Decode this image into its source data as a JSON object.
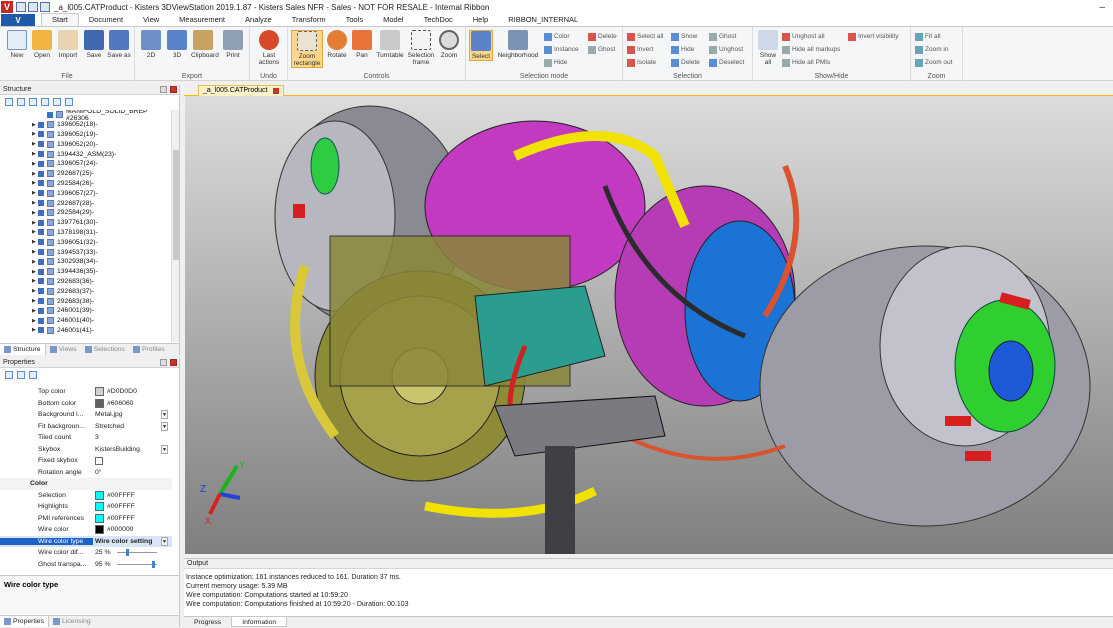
{
  "window": {
    "title": "_a_l005.CATProduct - Kisters 3DViewStation 2019.1.87 - Kisters Sales NFR - Sales - NOT FOR RESALE - Internal Ribbon",
    "logo": "V",
    "minimize_glyph": "–"
  },
  "menu": {
    "app_button": "V",
    "tabs": [
      "Start",
      "Document",
      "View",
      "Measurement",
      "Analyze",
      "Transform",
      "Tools",
      "Model",
      "TechDoc",
      "Help",
      "RIBBON_INTERNAL"
    ],
    "active_tab": "Start"
  },
  "ribbon": {
    "file": {
      "label": "File",
      "buttons": [
        "New",
        "Open",
        "Import",
        "Save",
        "Save as"
      ]
    },
    "export": {
      "label": "Export",
      "buttons": [
        "2D",
        "3D",
        "Clipboard",
        "Print"
      ]
    },
    "undo": {
      "label": "Undo",
      "buttons": [
        "Last actions"
      ]
    },
    "controls": {
      "label": "Controls",
      "buttons": [
        "Zoom rectangle",
        "Rotate",
        "Pan",
        "Turntable",
        "Selection frame",
        "Zoom"
      ]
    },
    "selection_mode": {
      "label": "Selection mode",
      "buttons": [
        "Select",
        "Neighborhood"
      ],
      "small": [
        "Color",
        "Delete",
        "Instance",
        "Ghost",
        "Hide"
      ]
    },
    "selection": {
      "label": "Selection",
      "small": [
        "Select all",
        "Show",
        "Ghost",
        "Invert",
        "Hide",
        "Unghost",
        "Isolate",
        "Delete",
        "Deselect"
      ]
    },
    "showhide": {
      "label": "Show/Hide",
      "buttons": [
        "Show all"
      ],
      "small": [
        "Unghost all",
        "Invert visibility",
        "Hide all markups",
        "Hide all PMIs"
      ]
    },
    "zoom": {
      "label": "Zoom",
      "small": [
        "Fit all",
        "Zoom in",
        "Zoom out"
      ]
    }
  },
  "structure": {
    "title": "Structure",
    "root": "MANIFOLD_SOLID_BREP #26306",
    "items": [
      "1396052(18)-",
      "1396052(19)-",
      "1396052(20)-",
      "1394432_ASM(23)-",
      "1396057(24)-",
      "292687(25)-",
      "292584(26)-",
      "1396057(27)-",
      "292687(28)-",
      "292584(29)-",
      "1397761(30)-",
      "1378198(31)-",
      "1396051(32)-",
      "1394537(33)-",
      "1302938(34)-",
      "1394436(35)-",
      "292683(36)-",
      "292683(37)-",
      "292683(38)-",
      "246001(39)-",
      "246001(40)-",
      "246001(41)-"
    ],
    "tabs": [
      "Structure",
      "Views",
      "Selections",
      "Profiles"
    ]
  },
  "properties": {
    "title": "Properties",
    "rows": [
      {
        "name": "Top color",
        "value": "#D0D0D0",
        "swatch": "#D0D0D0"
      },
      {
        "name": "Bottom color",
        "value": "#606060",
        "swatch": "#606060"
      },
      {
        "name": "Background i...",
        "value": "Metal.jpg",
        "dropdown": true
      },
      {
        "name": "Fit backgroun...",
        "value": "Stretched",
        "dropdown": true
      },
      {
        "name": "Tiled count",
        "value": "3"
      },
      {
        "name": "Skybox",
        "value": "KistersBuilding",
        "dropdown": true
      },
      {
        "name": "Fixed skybox",
        "value": "",
        "checkbox": true
      },
      {
        "name": "Rotation angle",
        "value": "0°"
      }
    ],
    "section": "Color",
    "color_rows": [
      {
        "name": "Selection",
        "value": "#00FFFF",
        "swatch": "#00FFFF"
      },
      {
        "name": "Highlights",
        "value": "#00FFFF",
        "swatch": "#00FFFF"
      },
      {
        "name": "PMI references",
        "value": "#00FFFF",
        "swatch": "#00FFFF"
      },
      {
        "name": "Wire color",
        "value": "#000000",
        "swatch": "#000000"
      }
    ],
    "selected_row": {
      "name": "Wire color type",
      "value": "Wire color setting"
    },
    "slider_rows": [
      {
        "name": "Wire color dif...",
        "value": "25 %",
        "level": 0.25
      },
      {
        "name": "Ghost transpa...",
        "value": "95 %",
        "level": 0.95
      }
    ],
    "description_title": "Wire color type",
    "tabs": [
      "Properties",
      "Licensing"
    ]
  },
  "document": {
    "tab_label": "_a_l005.CATProduct"
  },
  "axes": {
    "x": "X",
    "y": "Y",
    "z": "Z"
  },
  "output": {
    "title": "Output",
    "lines": [
      "Instance optimization: 161 instances reduced to 161. Duration 37 ms.",
      "Current memory usage: 5.39 MB",
      "Wire computation: Computations started at 10:59:20",
      "Wire computation: Computations finished at 10:59:20 - Duration: 00.103"
    ],
    "tabs": [
      "Progress",
      "Information"
    ]
  },
  "colors": {
    "accent": "#1E5AA8",
    "selection_highlight": "#FCD68A",
    "doc_tab": "#FCF2C8"
  }
}
